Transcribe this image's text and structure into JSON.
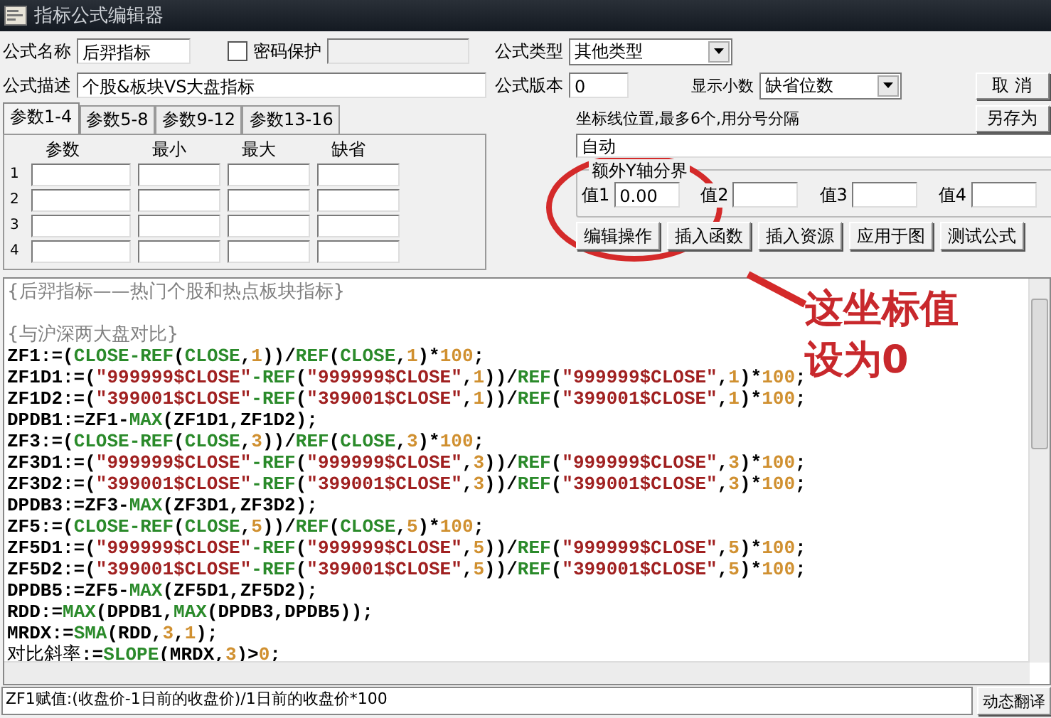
{
  "window": {
    "title": "指标公式编辑器"
  },
  "formula": {
    "name_label": "公式名称",
    "name": "后羿指标",
    "password": {
      "label": "密码保护",
      "checked": false
    },
    "desc_label": "公式描述",
    "desc": "个股&板块VS大盘指标",
    "type_label": "公式类型",
    "type": "其他类型",
    "version_label": "公式版本",
    "version": "0",
    "decimals_label": "显示小数",
    "decimals": "缺省位数"
  },
  "param_tabs": [
    {
      "label": "参数1-4",
      "selected": true
    },
    {
      "label": "参数5-8",
      "selected": false
    },
    {
      "label": "参数9-12",
      "selected": false
    },
    {
      "label": "参数13-16",
      "selected": false
    }
  ],
  "param_table": {
    "columns": [
      "参数",
      "最小",
      "最大",
      "缺省"
    ],
    "rows": [
      "1",
      "2",
      "3",
      "4"
    ]
  },
  "side_buttons": [
    "取 消",
    "另存为"
  ],
  "axis": {
    "label": "坐标线位置,最多6个,用分号分隔",
    "value": "自动",
    "group_title": "额外Y轴分界",
    "values": [
      {
        "label": "值1",
        "value": "0.00"
      },
      {
        "label": "值2"
      },
      {
        "label": "值3"
      },
      {
        "label": "值4"
      }
    ]
  },
  "action_buttons": [
    "编辑操作",
    "插入函数",
    "插入资源",
    "应用于图",
    "测试公式"
  ],
  "code_lines": [
    {
      "kind": "code",
      "tokens": [
        {
          "kind": "rem",
          "text": "{后羿指标——热门个股和热点板块指标}"
        }
      ]
    },
    {
      "kind": "blank"
    },
    {
      "kind": "code",
      "tokens": [
        {
          "kind": "rem",
          "text": "{与沪深两大盘对比}"
        }
      ]
    },
    {
      "kind": "code",
      "tokens": [
        {
          "kind": "id",
          "text": "ZF1:=("
        },
        {
          "kind": "fn",
          "text": "CLOSE-REF"
        },
        {
          "kind": "id",
          "text": "("
        },
        {
          "kind": "fn",
          "text": "CLOSE"
        },
        {
          "kind": "id",
          "text": ","
        },
        {
          "kind": "num",
          "text": "1"
        },
        {
          "kind": "id",
          "text": "))/"
        },
        {
          "kind": "fn",
          "text": "REF"
        },
        {
          "kind": "id",
          "text": "("
        },
        {
          "kind": "fn",
          "text": "CLOSE"
        },
        {
          "kind": "id",
          "text": ","
        },
        {
          "kind": "num",
          "text": "1"
        },
        {
          "kind": "id",
          "text": ")*"
        },
        {
          "kind": "num",
          "text": "100"
        },
        {
          "kind": "id",
          "text": ";"
        }
      ]
    },
    {
      "kind": "code",
      "tokens": [
        {
          "kind": "id",
          "text": "ZF1D1:=("
        },
        {
          "kind": "str",
          "text": "\"999999$CLOSE\""
        },
        {
          "kind": "fn",
          "text": "-REF"
        },
        {
          "kind": "id",
          "text": "("
        },
        {
          "kind": "str",
          "text": "\"999999$CLOSE\""
        },
        {
          "kind": "id",
          "text": ","
        },
        {
          "kind": "num",
          "text": "1"
        },
        {
          "kind": "id",
          "text": "))/"
        },
        {
          "kind": "fn",
          "text": "REF"
        },
        {
          "kind": "id",
          "text": "("
        },
        {
          "kind": "str",
          "text": "\"999999$CLOSE\""
        },
        {
          "kind": "id",
          "text": ","
        },
        {
          "kind": "num",
          "text": "1"
        },
        {
          "kind": "id",
          "text": ")*"
        },
        {
          "kind": "num",
          "text": "100"
        },
        {
          "kind": "id",
          "text": ";"
        }
      ]
    },
    {
      "kind": "code",
      "tokens": [
        {
          "kind": "id",
          "text": "ZF1D2:=("
        },
        {
          "kind": "str",
          "text": "\"399001$CLOSE\""
        },
        {
          "kind": "fn",
          "text": "-REF"
        },
        {
          "kind": "id",
          "text": "("
        },
        {
          "kind": "str",
          "text": "\"399001$CLOSE\""
        },
        {
          "kind": "id",
          "text": ","
        },
        {
          "kind": "num",
          "text": "1"
        },
        {
          "kind": "id",
          "text": "))/"
        },
        {
          "kind": "fn",
          "text": "REF"
        },
        {
          "kind": "id",
          "text": "("
        },
        {
          "kind": "str",
          "text": "\"399001$CLOSE\""
        },
        {
          "kind": "id",
          "text": ","
        },
        {
          "kind": "num",
          "text": "1"
        },
        {
          "kind": "id",
          "text": ")*"
        },
        {
          "kind": "num",
          "text": "100"
        },
        {
          "kind": "id",
          "text": ";"
        }
      ]
    },
    {
      "kind": "code",
      "tokens": [
        {
          "kind": "id",
          "text": "DPDB1:=ZF1-"
        },
        {
          "kind": "fn",
          "text": "MAX"
        },
        {
          "kind": "id",
          "text": "(ZF1D1,ZF1D2);"
        }
      ]
    },
    {
      "kind": "code",
      "tokens": [
        {
          "kind": "id",
          "text": "ZF3:=("
        },
        {
          "kind": "fn",
          "text": "CLOSE-REF"
        },
        {
          "kind": "id",
          "text": "("
        },
        {
          "kind": "fn",
          "text": "CLOSE"
        },
        {
          "kind": "id",
          "text": ","
        },
        {
          "kind": "num",
          "text": "3"
        },
        {
          "kind": "id",
          "text": "))/"
        },
        {
          "kind": "fn",
          "text": "REF"
        },
        {
          "kind": "id",
          "text": "("
        },
        {
          "kind": "fn",
          "text": "CLOSE"
        },
        {
          "kind": "id",
          "text": ","
        },
        {
          "kind": "num",
          "text": "3"
        },
        {
          "kind": "id",
          "text": ")*"
        },
        {
          "kind": "num",
          "text": "100"
        },
        {
          "kind": "id",
          "text": ";"
        }
      ]
    },
    {
      "kind": "code",
      "tokens": [
        {
          "kind": "id",
          "text": "ZF3D1:=("
        },
        {
          "kind": "str",
          "text": "\"999999$CLOSE\""
        },
        {
          "kind": "fn",
          "text": "-REF"
        },
        {
          "kind": "id",
          "text": "("
        },
        {
          "kind": "str",
          "text": "\"999999$CLOSE\""
        },
        {
          "kind": "id",
          "text": ","
        },
        {
          "kind": "num",
          "text": "3"
        },
        {
          "kind": "id",
          "text": "))/"
        },
        {
          "kind": "fn",
          "text": "REF"
        },
        {
          "kind": "id",
          "text": "("
        },
        {
          "kind": "str",
          "text": "\"999999$CLOSE\""
        },
        {
          "kind": "id",
          "text": ","
        },
        {
          "kind": "num",
          "text": "3"
        },
        {
          "kind": "id",
          "text": ")*"
        },
        {
          "kind": "num",
          "text": "100"
        },
        {
          "kind": "id",
          "text": ";"
        }
      ]
    },
    {
      "kind": "code",
      "tokens": [
        {
          "kind": "id",
          "text": "ZF3D2:=("
        },
        {
          "kind": "str",
          "text": "\"399001$CLOSE\""
        },
        {
          "kind": "fn",
          "text": "-REF"
        },
        {
          "kind": "id",
          "text": "("
        },
        {
          "kind": "str",
          "text": "\"399001$CLOSE\""
        },
        {
          "kind": "id",
          "text": ","
        },
        {
          "kind": "num",
          "text": "3"
        },
        {
          "kind": "id",
          "text": "))/"
        },
        {
          "kind": "fn",
          "text": "REF"
        },
        {
          "kind": "id",
          "text": "("
        },
        {
          "kind": "str",
          "text": "\"399001$CLOSE\""
        },
        {
          "kind": "id",
          "text": ","
        },
        {
          "kind": "num",
          "text": "3"
        },
        {
          "kind": "id",
          "text": ")*"
        },
        {
          "kind": "num",
          "text": "100"
        },
        {
          "kind": "id",
          "text": ";"
        }
      ]
    },
    {
      "kind": "code",
      "tokens": [
        {
          "kind": "id",
          "text": "DPDB3:=ZF3-"
        },
        {
          "kind": "fn",
          "text": "MAX"
        },
        {
          "kind": "id",
          "text": "(ZF3D1,ZF3D2);"
        }
      ]
    },
    {
      "kind": "code",
      "tokens": [
        {
          "kind": "id",
          "text": "ZF5:=("
        },
        {
          "kind": "fn",
          "text": "CLOSE-REF"
        },
        {
          "kind": "id",
          "text": "("
        },
        {
          "kind": "fn",
          "text": "CLOSE"
        },
        {
          "kind": "id",
          "text": ","
        },
        {
          "kind": "num",
          "text": "5"
        },
        {
          "kind": "id",
          "text": "))/"
        },
        {
          "kind": "fn",
          "text": "REF"
        },
        {
          "kind": "id",
          "text": "("
        },
        {
          "kind": "fn",
          "text": "CLOSE"
        },
        {
          "kind": "id",
          "text": ","
        },
        {
          "kind": "num",
          "text": "5"
        },
        {
          "kind": "id",
          "text": ")*"
        },
        {
          "kind": "num",
          "text": "100"
        },
        {
          "kind": "id",
          "text": ";"
        }
      ]
    },
    {
      "kind": "code",
      "tokens": [
        {
          "kind": "id",
          "text": "ZF5D1:=("
        },
        {
          "kind": "str",
          "text": "\"999999$CLOSE\""
        },
        {
          "kind": "fn",
          "text": "-REF"
        },
        {
          "kind": "id",
          "text": "("
        },
        {
          "kind": "str",
          "text": "\"999999$CLOSE\""
        },
        {
          "kind": "id",
          "text": ","
        },
        {
          "kind": "num",
          "text": "5"
        },
        {
          "kind": "id",
          "text": "))/"
        },
        {
          "kind": "fn",
          "text": "REF"
        },
        {
          "kind": "id",
          "text": "("
        },
        {
          "kind": "str",
          "text": "\"999999$CLOSE\""
        },
        {
          "kind": "id",
          "text": ","
        },
        {
          "kind": "num",
          "text": "5"
        },
        {
          "kind": "id",
          "text": ")*"
        },
        {
          "kind": "num",
          "text": "100"
        },
        {
          "kind": "id",
          "text": ";"
        }
      ]
    },
    {
      "kind": "code",
      "tokens": [
        {
          "kind": "id",
          "text": "ZF5D2:=("
        },
        {
          "kind": "str",
          "text": "\"399001$CLOSE\""
        },
        {
          "kind": "fn",
          "text": "-REF"
        },
        {
          "kind": "id",
          "text": "("
        },
        {
          "kind": "str",
          "text": "\"399001$CLOSE\""
        },
        {
          "kind": "id",
          "text": ","
        },
        {
          "kind": "num",
          "text": "5"
        },
        {
          "kind": "id",
          "text": "))/"
        },
        {
          "kind": "fn",
          "text": "REF"
        },
        {
          "kind": "id",
          "text": "("
        },
        {
          "kind": "str",
          "text": "\"399001$CLOSE\""
        },
        {
          "kind": "id",
          "text": ","
        },
        {
          "kind": "num",
          "text": "5"
        },
        {
          "kind": "id",
          "text": ")*"
        },
        {
          "kind": "num",
          "text": "100"
        },
        {
          "kind": "id",
          "text": ";"
        }
      ]
    },
    {
      "kind": "code",
      "tokens": [
        {
          "kind": "id",
          "text": "DPDB5:=ZF5-"
        },
        {
          "kind": "fn",
          "text": "MAX"
        },
        {
          "kind": "id",
          "text": "(ZF5D1,ZF5D2);"
        }
      ]
    },
    {
      "kind": "code",
      "tokens": [
        {
          "kind": "id",
          "text": "RDD:="
        },
        {
          "kind": "fn",
          "text": "MAX"
        },
        {
          "kind": "id",
          "text": "(DPDB1,"
        },
        {
          "kind": "fn",
          "text": "MAX"
        },
        {
          "kind": "id",
          "text": "(DPDB3,DPDB5));"
        }
      ]
    },
    {
      "kind": "code",
      "tokens": [
        {
          "kind": "id",
          "text": "MRDX:="
        },
        {
          "kind": "fn",
          "text": "SMA"
        },
        {
          "kind": "id",
          "text": "(RDD,"
        },
        {
          "kind": "num",
          "text": "3"
        },
        {
          "kind": "id",
          "text": ","
        },
        {
          "kind": "num",
          "text": "1"
        },
        {
          "kind": "id",
          "text": ");"
        }
      ]
    },
    {
      "kind": "code",
      "tokens": [
        {
          "kind": "cjk",
          "text": "对比斜率"
        },
        {
          "kind": "id",
          "text": ":="
        },
        {
          "kind": "fn",
          "text": "SLOPE"
        },
        {
          "kind": "id",
          "text": "(MRDX,"
        },
        {
          "kind": "num",
          "text": "3"
        },
        {
          "kind": "id",
          "text": ")>"
        },
        {
          "kind": "num",
          "text": "0"
        },
        {
          "kind": "id",
          "text": ";"
        }
      ]
    }
  ],
  "status_text": "ZF1赋值:(收盘价-1日前的收盘价)/1日前的收盘价*100",
  "translate_button": "动态翻译",
  "annotation": {
    "text": "这坐标值设为0"
  }
}
